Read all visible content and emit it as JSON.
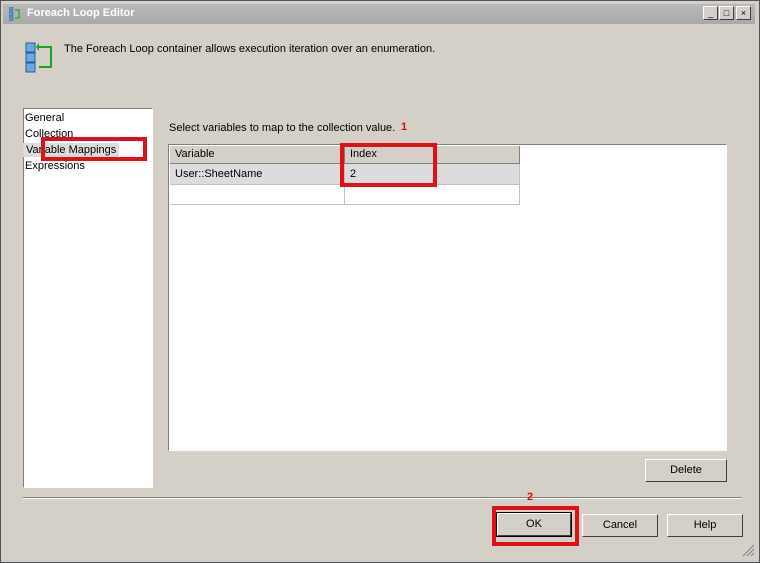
{
  "window": {
    "title": "Foreach Loop Editor",
    "controls": {
      "minimize": "_",
      "maximize": "□",
      "close": "×"
    }
  },
  "header": {
    "description": "The Foreach Loop container allows execution iteration over an enumeration.",
    "icon": "foreach-loop-icon"
  },
  "nav": {
    "items": [
      {
        "label": "General"
      },
      {
        "label": "Collection"
      },
      {
        "label": "Variable Mappings",
        "selected": true
      },
      {
        "label": "Expressions"
      }
    ]
  },
  "main": {
    "instruction": "Select variables to map to the collection value.",
    "grid": {
      "columns": [
        "Variable",
        "Index"
      ],
      "rows": [
        {
          "variable": "User::SheetName",
          "index": "2"
        },
        {
          "variable": "",
          "index": ""
        }
      ]
    },
    "delete_label": "Delete"
  },
  "annotations": {
    "step1": "1",
    "step2": "2",
    "color": "#e0101a"
  },
  "footer": {
    "ok_label": "OK",
    "cancel_label": "Cancel",
    "help_label": "Help"
  }
}
